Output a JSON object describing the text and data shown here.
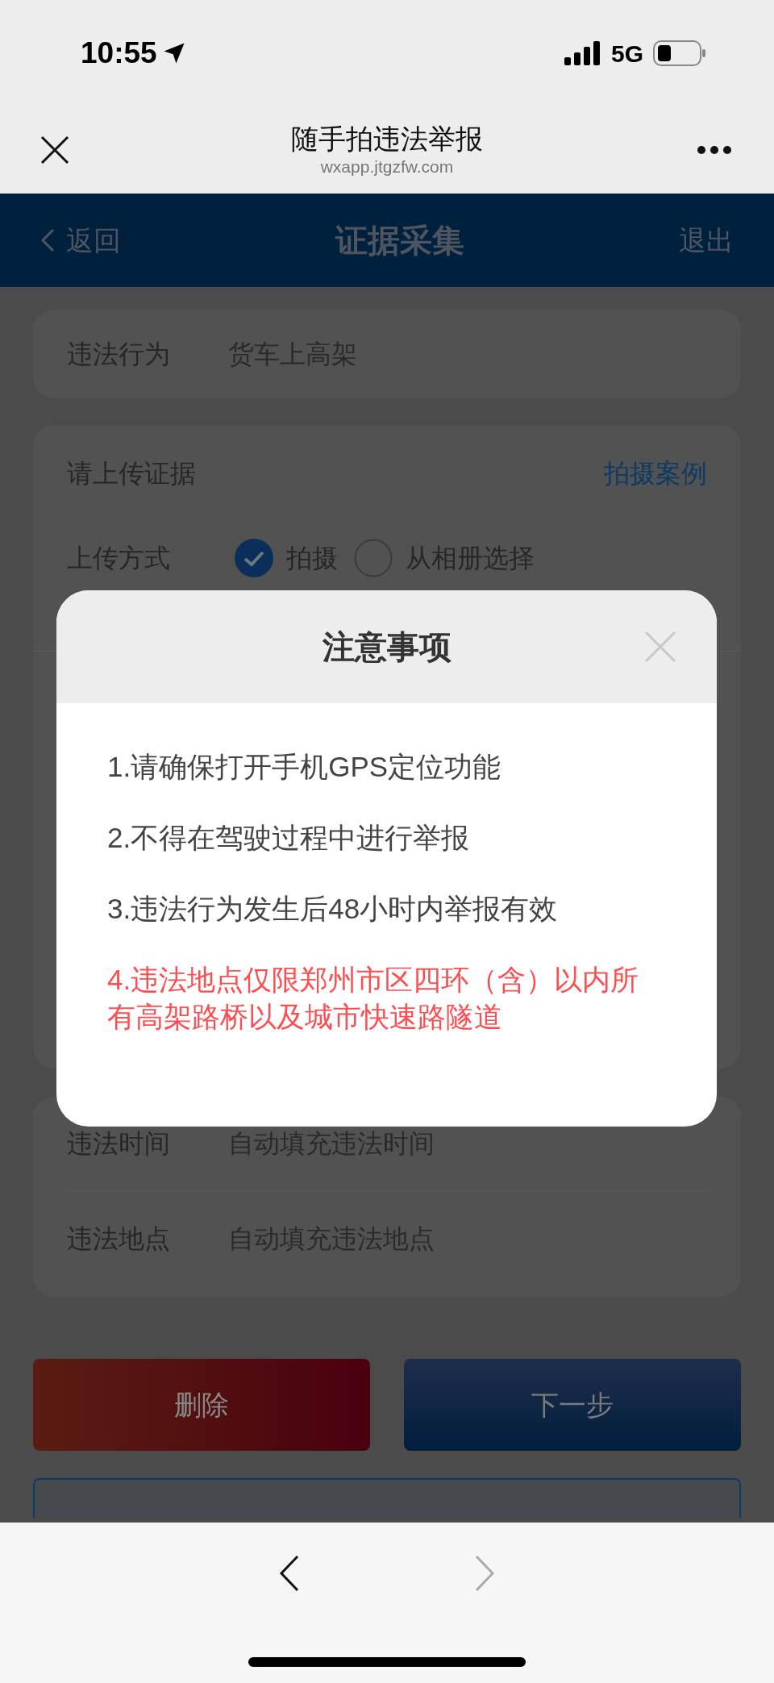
{
  "status_bar": {
    "time": "10:55",
    "network": "5G"
  },
  "browser": {
    "title": "随手拍违法举报",
    "url": "wxapp.jtgzfw.com"
  },
  "nav": {
    "back": "返回",
    "title": "证据采集",
    "exit": "退出"
  },
  "violation": {
    "label": "违法行为",
    "value": "货车上高架"
  },
  "evidence": {
    "title": "请上传证据",
    "example_link": "拍摄案例",
    "upload_label": "上传方式",
    "options": [
      {
        "label": "拍摄",
        "selected": true
      },
      {
        "label": "从相册选择",
        "selected": false
      }
    ]
  },
  "auto_fields": [
    {
      "label": "违法时间",
      "placeholder": "自动填充违法时间"
    },
    {
      "label": "违法地点",
      "placeholder": "自动填充违法地点"
    }
  ],
  "buttons": [
    {
      "label": "删除",
      "kind": "danger"
    },
    {
      "label": "下一步",
      "kind": "primary"
    }
  ],
  "dialog": {
    "title": "注意事项",
    "items": [
      {
        "text": "1.请确保打开手机GPS定位功能",
        "highlight": false
      },
      {
        "text": "2.不得在驾驶过程中进行举报",
        "highlight": false
      },
      {
        "text": "3.违法行为发生后48小时内举报有效",
        "highlight": false
      },
      {
        "text": "4.违法地点仅限郑州市区四环（含）以内所有高架路桥以及城市快速路隧道",
        "highlight": true
      }
    ]
  }
}
